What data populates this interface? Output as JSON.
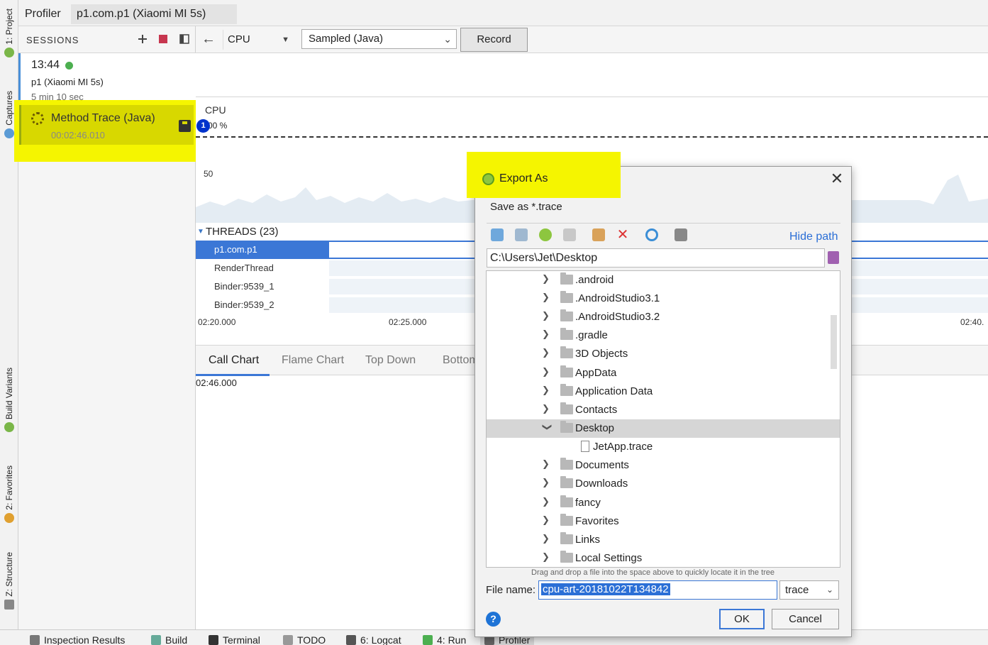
{
  "top_tabs": {
    "profiler": "Profiler",
    "session_tab": "p1.com.p1 (Xiaomi MI 5s)"
  },
  "left_tool_strip": [
    "1: Project",
    "Captures",
    "Build Variants",
    "2: Favorites",
    "Z: Structure"
  ],
  "sessions": {
    "title": "SESSIONS",
    "add_icon": "plus-icon",
    "stop_icon": "stop-icon",
    "layout_icon": "layout-icon",
    "session_time": "13:44",
    "session_device": "p1 (Xiaomi MI 5s)",
    "session_duration": "5 min 10 sec",
    "status_color": "#4caf50"
  },
  "capture": {
    "title": "Method Trace (Java)",
    "time": "00:02:46.010",
    "save_icon": "save-icon"
  },
  "toolbar": {
    "back_icon": "back-arrow-icon",
    "monitor_select": "CPU",
    "mode_select": "Sampled (Java)",
    "record_label": "Record"
  },
  "cpu_chart": {
    "label": "CPU",
    "pct_top": "00 %",
    "badge": "1",
    "pct_mid": "50"
  },
  "threads": {
    "title": "THREADS (23)",
    "rows": [
      "p1.com.p1",
      "RenderThread",
      "Binder:9539_1",
      "Binder:9539_2"
    ],
    "ticks": [
      "02:20.000",
      "02:25.000",
      "02:40."
    ]
  },
  "analysis_tabs": {
    "call_chart": "Call Chart",
    "flame_chart": "Flame Chart",
    "top_down": "Top Down",
    "bottom_up": "Bottom"
  },
  "call_chart_time": "02:46.000",
  "status_bar": [
    "Inspection Results",
    "Build",
    "Terminal",
    "TODO",
    "6: Logcat",
    "4: Run",
    "Profiler"
  ],
  "dialog": {
    "title": "Export As",
    "subtitle": "Save as *.trace",
    "hide_path": "Hide path",
    "path": "C:\\Users\\Jet\\Desktop",
    "tool_icons": [
      "home-icon",
      "desktop-icon",
      "android-project-icon",
      "folder-icon",
      "new-folder-icon",
      "delete-icon",
      "refresh-icon",
      "show-hidden-icon"
    ],
    "tree": [
      {
        "label": ".android",
        "type": "folder"
      },
      {
        "label": ".AndroidStudio3.1",
        "type": "folder"
      },
      {
        "label": ".AndroidStudio3.2",
        "type": "folder"
      },
      {
        "label": ".gradle",
        "type": "folder"
      },
      {
        "label": "3D Objects",
        "type": "folder"
      },
      {
        "label": "AppData",
        "type": "folder"
      },
      {
        "label": "Application Data",
        "type": "folder"
      },
      {
        "label": "Contacts",
        "type": "folder"
      },
      {
        "label": "Desktop",
        "type": "folder",
        "selected": true
      },
      {
        "label": "JetApp.trace",
        "type": "file"
      },
      {
        "label": "Documents",
        "type": "folder"
      },
      {
        "label": "Downloads",
        "type": "folder"
      },
      {
        "label": "fancy",
        "type": "folder"
      },
      {
        "label": "Favorites",
        "type": "folder"
      },
      {
        "label": "Links",
        "type": "folder"
      },
      {
        "label": "Local Settings",
        "type": "folder"
      }
    ],
    "drag_hint": "Drag and drop a file into the space above to quickly locate it in the tree",
    "file_name_label": "File name:",
    "file_name_value": "cpu-art-20181022T134842",
    "file_type": "trace",
    "help": "?",
    "ok": "OK",
    "cancel": "Cancel"
  },
  "colors": {
    "highlight": "#f5f500",
    "accent": "#3b77d6"
  }
}
